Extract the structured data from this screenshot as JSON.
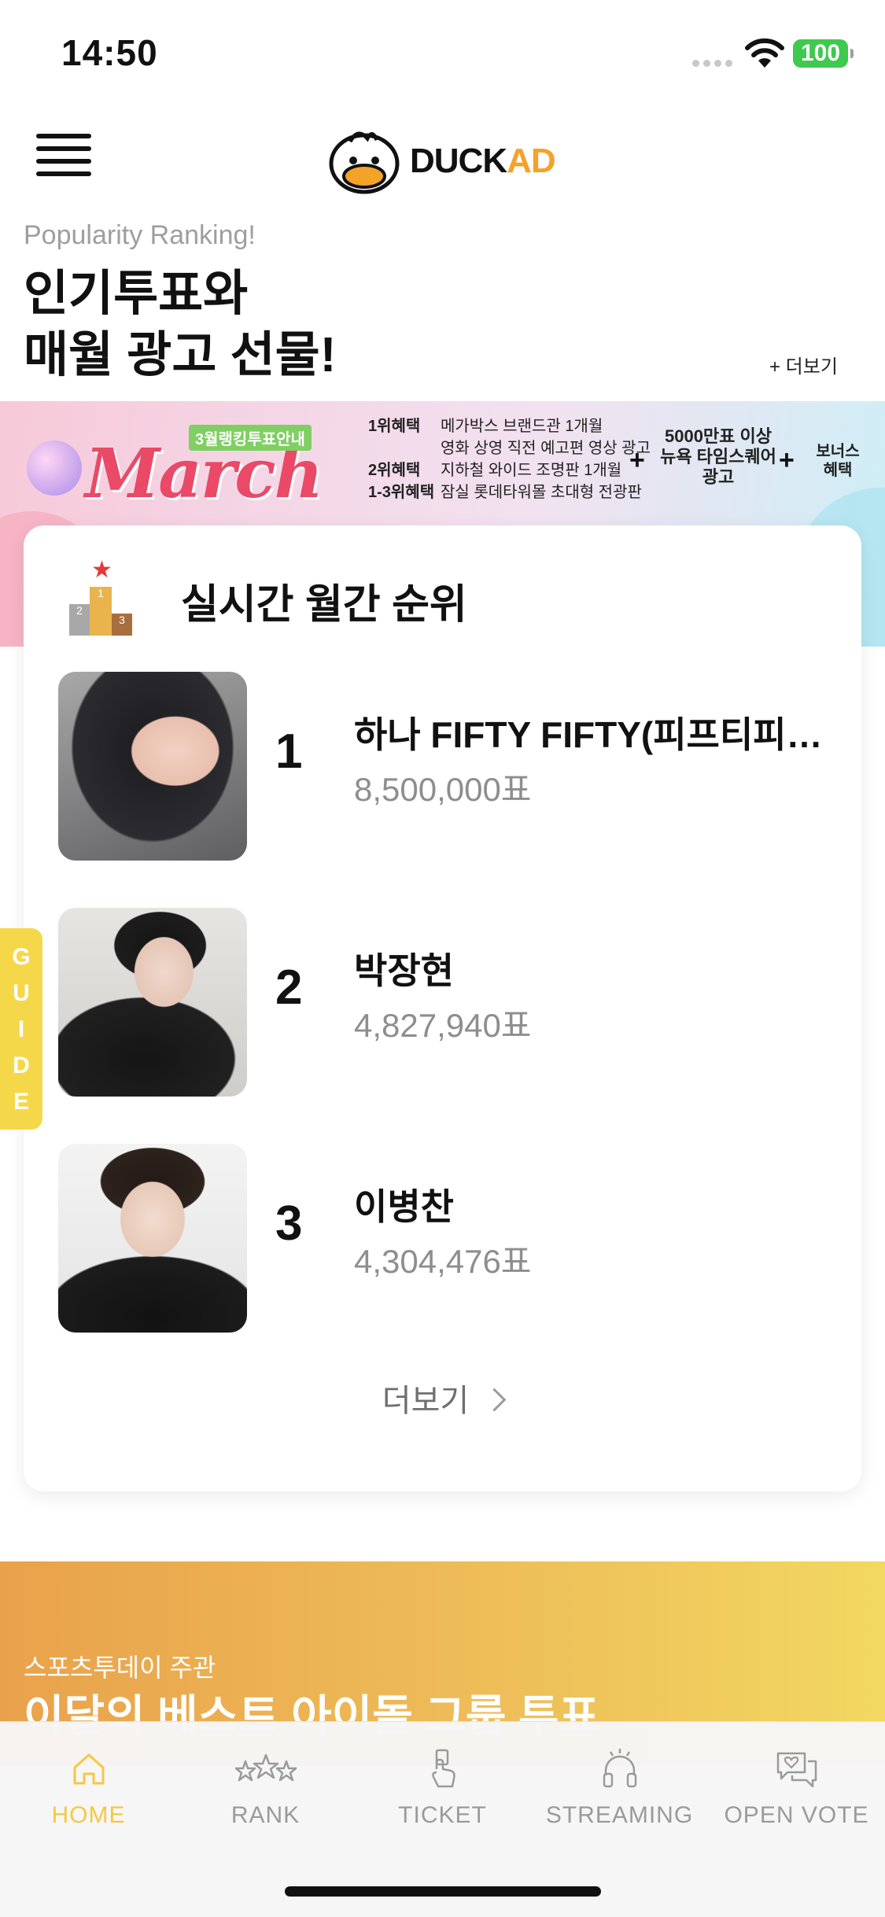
{
  "status_bar": {
    "time": "14:50",
    "battery": "100"
  },
  "header": {
    "logo_text_a": "DUCK",
    "logo_text_b": "AD"
  },
  "intro": {
    "subtitle": "Popularity Ranking!",
    "title_line1": "인기투표와",
    "title_line2": "매월 광고 선물!",
    "more_label": "+ 더보기"
  },
  "banner": {
    "tag": "3월랭킹투표안내",
    "title": "March",
    "benefits": [
      {
        "label": "1위혜택",
        "text": "메가박스 브랜드관 1개월"
      },
      {
        "label": "",
        "text": "영화 상영 직전 예고편 영상 광고"
      },
      {
        "label": "2위혜택",
        "text": "지하철 와이드 조명판 1개월"
      },
      {
        "label": "1-3위혜택",
        "text": "잠실 롯데타워몰 초대형 전광판"
      }
    ],
    "middle": "5000만표 이상 뉴욕 타임스퀘어 광고",
    "bonus": "보너스 혜택"
  },
  "ranking": {
    "title": "실시간 월간 순위",
    "items": [
      {
        "rank": "1",
        "name": "하나 FIFTY FIFTY(피프티피프티)",
        "votes": "8,500,000표"
      },
      {
        "rank": "2",
        "name": "박장현",
        "votes": "4,827,940표"
      },
      {
        "rank": "3",
        "name": "이병찬",
        "votes": "4,304,476표"
      }
    ],
    "more_label": "더보기"
  },
  "guide": {
    "letters": [
      "G",
      "U",
      "I",
      "D",
      "E"
    ]
  },
  "promo": {
    "subtitle": "스포츠투데이 주관",
    "title": "이달의 베스트 아이돌 그룹 투표"
  },
  "tabbar": {
    "tabs": [
      {
        "label": "HOME",
        "icon": "home-icon",
        "active": true
      },
      {
        "label": "RANK",
        "icon": "stars-icon",
        "active": false
      },
      {
        "label": "TICKET",
        "icon": "ticket-hand-icon",
        "active": false
      },
      {
        "label": "STREAMING",
        "icon": "headphones-icon",
        "active": false
      },
      {
        "label": "OPEN VOTE",
        "icon": "chat-heart-icon",
        "active": false
      }
    ],
    "active_color": "#F5C842",
    "inactive_color": "#9A9A9A"
  }
}
